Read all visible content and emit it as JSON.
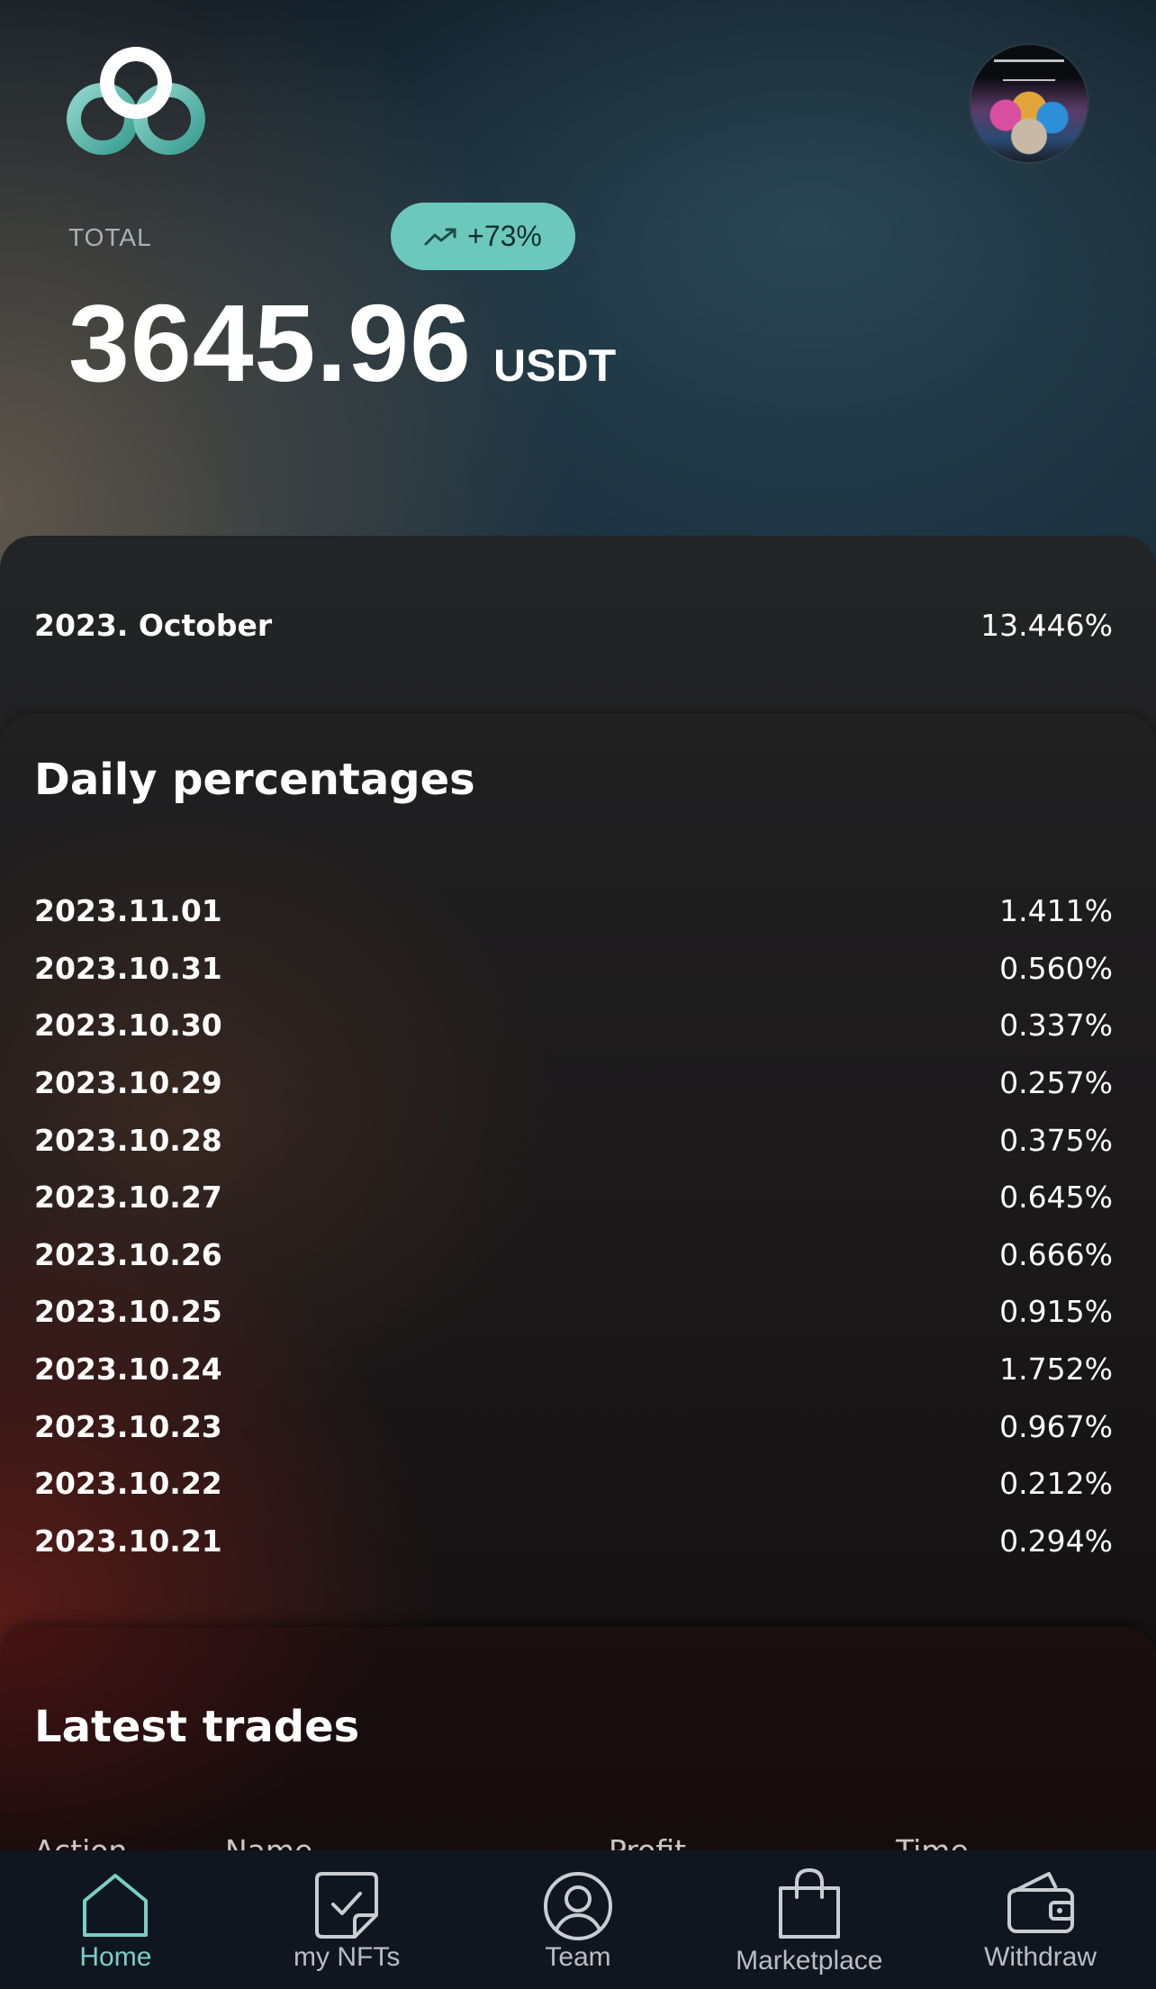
{
  "header": {
    "total_label": "TOTAL",
    "change_badge": "+73%",
    "amount": "3645.96",
    "currency": "USDT"
  },
  "month": {
    "title": "2023. October",
    "value": "13.446%"
  },
  "daily": {
    "title": "Daily percentages",
    "rows": [
      {
        "date": "2023.11.01",
        "value": "1.411%"
      },
      {
        "date": "2023.10.31",
        "value": "0.560%"
      },
      {
        "date": "2023.10.30",
        "value": "0.337%"
      },
      {
        "date": "2023.10.29",
        "value": "0.257%"
      },
      {
        "date": "2023.10.28",
        "value": "0.375%"
      },
      {
        "date": "2023.10.27",
        "value": "0.645%"
      },
      {
        "date": "2023.10.26",
        "value": "0.666%"
      },
      {
        "date": "2023.10.25",
        "value": "0.915%"
      },
      {
        "date": "2023.10.24",
        "value": "1.752%"
      },
      {
        "date": "2023.10.23",
        "value": "0.967%"
      },
      {
        "date": "2023.10.22",
        "value": "0.212%"
      },
      {
        "date": "2023.10.21",
        "value": "0.294%"
      }
    ]
  },
  "trades": {
    "title": "Latest trades",
    "columns": [
      "Action",
      "Name",
      "Profit",
      "Time"
    ]
  },
  "nav": {
    "items": [
      {
        "label": "Home",
        "icon": "home-icon",
        "active": true
      },
      {
        "label": "my NFTs",
        "icon": "nft-check-icon",
        "active": false
      },
      {
        "label": "Team",
        "icon": "user-circle-icon",
        "active": false
      },
      {
        "label": "Marketplace",
        "icon": "shopping-bag-icon",
        "active": false
      },
      {
        "label": "Withdraw",
        "icon": "wallet-icon",
        "active": false
      }
    ]
  },
  "colors": {
    "accent": "#79cfc5",
    "badge_bg": "#6cc8bd"
  }
}
